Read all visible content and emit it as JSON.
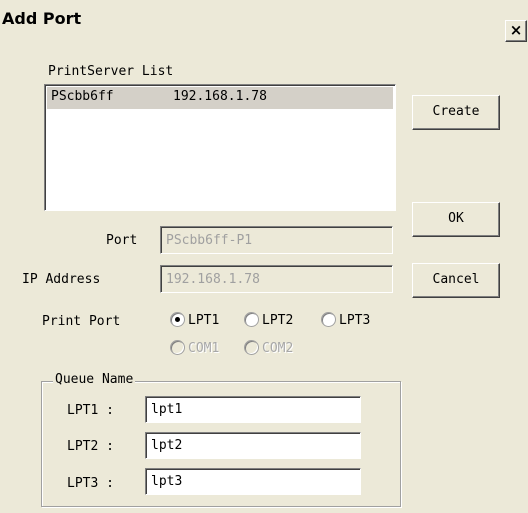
{
  "window": {
    "title": "Add Port",
    "close_glyph": "×"
  },
  "printserver_list": {
    "label": "PrintServer List",
    "items": [
      {
        "name": "PScbb6ff",
        "ip": "192.168.1.78"
      }
    ]
  },
  "buttons": {
    "create": "Create",
    "ok": "OK",
    "cancel": "Cancel"
  },
  "port": {
    "label": "Port",
    "value": "PScbb6ff-P1"
  },
  "ip_address": {
    "label": "IP Address",
    "value": "192.168.1.78"
  },
  "print_port": {
    "label": "Print Port",
    "selected": "LPT1",
    "options": [
      {
        "label": "LPT1",
        "enabled": true
      },
      {
        "label": "LPT2",
        "enabled": true
      },
      {
        "label": "LPT3",
        "enabled": true
      },
      {
        "label": "COM1",
        "enabled": false
      },
      {
        "label": "COM2",
        "enabled": false
      }
    ]
  },
  "queue_name": {
    "title": "Queue Name",
    "rows": [
      {
        "label": "LPT1 :",
        "value": "lpt1"
      },
      {
        "label": "LPT2 :",
        "value": "lpt2"
      },
      {
        "label": "LPT3 :",
        "value": "lpt3"
      }
    ]
  }
}
